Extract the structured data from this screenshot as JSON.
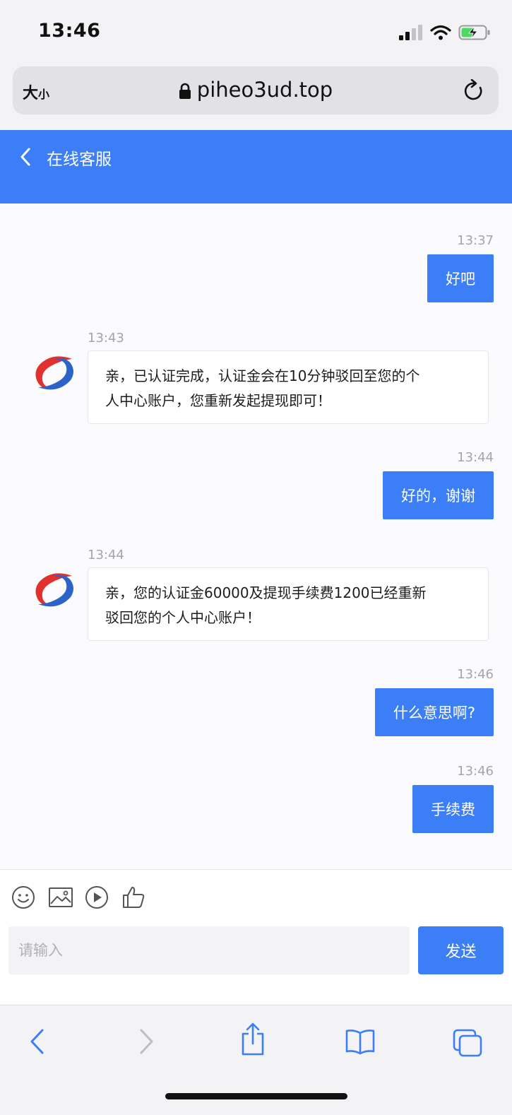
{
  "status_bar": {
    "time": "13:46"
  },
  "browser": {
    "text_size_label_big": "大",
    "text_size_label_small": "小",
    "url": "piheo3ud.top"
  },
  "chat_header": {
    "title": "在线客服"
  },
  "messages": [
    {
      "direction": "out",
      "time": "13:37",
      "text": "好吧"
    },
    {
      "direction": "in",
      "time": "13:43",
      "line1": "亲，已认证完成，认证金会在10分钟驳回至您的个",
      "line2": "人中心账户，您重新发起提现即可！"
    },
    {
      "direction": "out",
      "time": "13:44",
      "text": "好的，谢谢"
    },
    {
      "direction": "in",
      "time": "13:44",
      "line1": "亲，您的认证金60000及提现手续费1200已经重新",
      "line2": "驳回您的个人中心账户！"
    },
    {
      "direction": "out",
      "time": "13:46",
      "text": "什么意思啊?"
    },
    {
      "direction": "out",
      "time": "13:46",
      "text": "手续费"
    }
  ],
  "composer": {
    "placeholder": "请输入",
    "send_label": "发送"
  },
  "colors": {
    "accent": "#3b7ef5",
    "avatar_red": "#e0312f",
    "avatar_blue": "#2b63c9"
  }
}
